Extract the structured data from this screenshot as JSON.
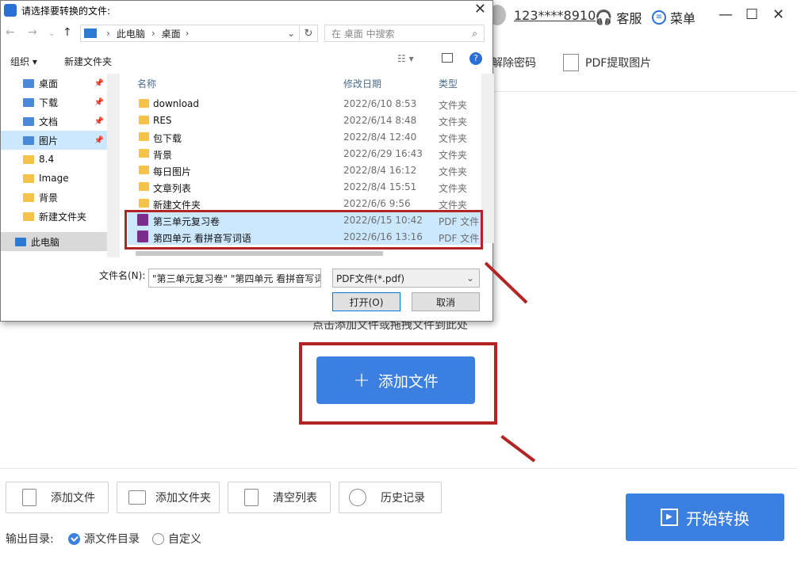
{
  "app": {
    "user": "123****8910",
    "service": "客服",
    "menu": "菜单",
    "tools": {
      "remove_password": "解除密码",
      "extract_images": "PDF提取图片"
    },
    "drop_hint": "点击添加文件或拖拽文件到此处",
    "add_file_big": "添加文件",
    "bottom_buttons": [
      "添加文件",
      "添加文件夹",
      "清空列表",
      "历史记录"
    ],
    "start": "开始转换",
    "output_label": "输出目录:",
    "output_options": [
      "源文件目录",
      "自定义"
    ],
    "output_selected": "源文件目录",
    "window_controls": [
      "—",
      "☐",
      "✕"
    ]
  },
  "dialog": {
    "title": "请选择要转换的文件:",
    "path": [
      "此电脑",
      "桌面"
    ],
    "search_placeholder": "在 桌面 中搜索",
    "organize": "组织 ▾",
    "new_folder": "新建文件夹",
    "nav_items": [
      {
        "label": "桌面",
        "pinned": true
      },
      {
        "label": "下载",
        "pinned": true
      },
      {
        "label": "文档",
        "pinned": true
      },
      {
        "label": "图片",
        "pinned": true,
        "selected": true
      },
      {
        "label": "8.4"
      },
      {
        "label": "Image"
      },
      {
        "label": "背景"
      },
      {
        "label": "新建文件夹"
      },
      {
        "label": "此电脑"
      }
    ],
    "columns": {
      "name": "名称",
      "date": "修改日期",
      "type": "类型"
    },
    "files": [
      {
        "name": "download",
        "date": "2022/6/10 8:53",
        "type": "文件夹",
        "kind": "folder"
      },
      {
        "name": "RES",
        "date": "2022/6/14 8:48",
        "type": "文件夹",
        "kind": "folder"
      },
      {
        "name": "包下载",
        "date": "2022/8/4 12:40",
        "type": "文件夹",
        "kind": "folder"
      },
      {
        "name": "背景",
        "date": "2022/6/29 16:43",
        "type": "文件夹",
        "kind": "folder"
      },
      {
        "name": "每日图片",
        "date": "2022/8/4 16:12",
        "type": "文件夹",
        "kind": "folder"
      },
      {
        "name": "文章列表",
        "date": "2022/8/4 15:51",
        "type": "文件夹",
        "kind": "folder"
      },
      {
        "name": "新建文件夹",
        "date": "2022/6/6 9:56",
        "type": "文件夹",
        "kind": "folder"
      },
      {
        "name": "第三单元复习卷",
        "date": "2022/6/15 10:42",
        "type": "PDF 文件",
        "kind": "pdf",
        "selected": true
      },
      {
        "name": "第四单元 看拼音写词语",
        "date": "2022/6/16 13:16",
        "type": "PDF 文件",
        "kind": "pdf",
        "selected": true
      }
    ],
    "filename_label": "文件名(N):",
    "filename_value": "\"第三单元复习卷\" \"第四单元 看拼音写词语\"",
    "filetype": "PDF文件(*.pdf)",
    "open": "打开(O)",
    "cancel": "取消",
    "accent": "#cce8ff"
  },
  "highlight_color": "#b32424",
  "accent": "#3b7fe0"
}
